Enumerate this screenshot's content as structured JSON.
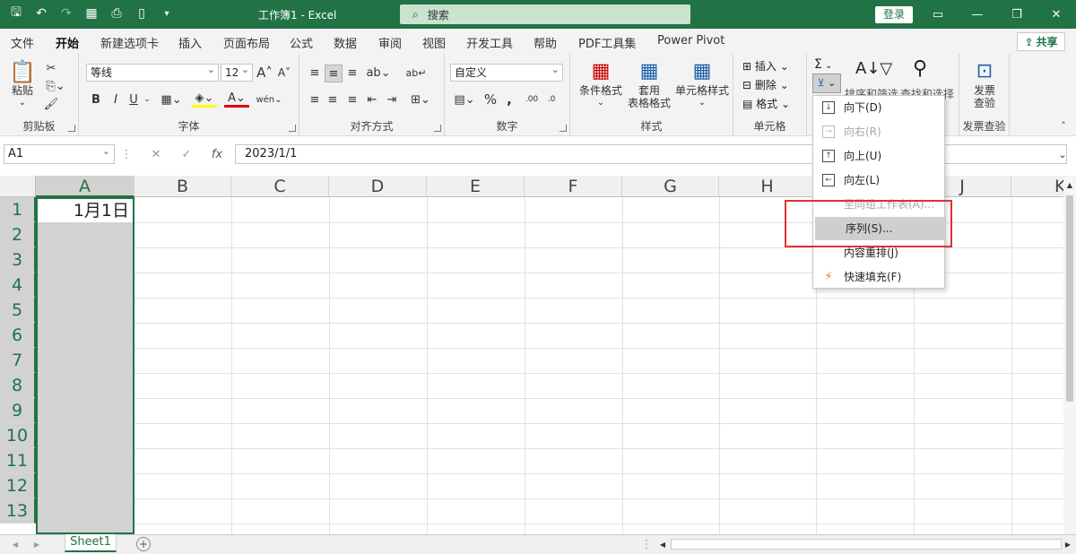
{
  "titlebar": {
    "title": "工作簿1  -  Excel",
    "search_placeholder": "搜索",
    "login_label": "登录"
  },
  "menu": {
    "tabs": [
      "文件",
      "开始",
      "新建选项卡",
      "插入",
      "页面布局",
      "公式",
      "数据",
      "审阅",
      "视图",
      "开发工具",
      "帮助",
      "PDF工具集",
      "Power Pivot"
    ],
    "active": "开始",
    "share_label": "共享"
  },
  "ribbon": {
    "clipboard": {
      "paste_label": "粘贴",
      "group_label": "剪贴板"
    },
    "font": {
      "font_name": "等线",
      "font_size": "12",
      "group_label": "字体",
      "bold": "B",
      "italic": "I",
      "underline": "U"
    },
    "alignment": {
      "group_label": "对齐方式"
    },
    "number": {
      "format": "自定义",
      "group_label": "数字",
      "percent": "%"
    },
    "styles": {
      "conditional_label": "条件格式",
      "table_label_1": "套用",
      "table_label_2": "表格格式",
      "cell_style_label": "单元格样式",
      "group_label": "样式"
    },
    "cells": {
      "insert_label": "插入",
      "delete_label": "删除",
      "format_label": "格式",
      "group_label": "单元格"
    },
    "editing": {
      "sum_symbol": "Σ",
      "sort_label": "排序和筛选",
      "find_label": "查找和选择"
    },
    "invoice": {
      "label_1": "发票",
      "label_2": "查验",
      "group_label": "发票查验"
    }
  },
  "formula": {
    "name_box": "A1",
    "fx": "fx",
    "value": "2023/1/1"
  },
  "grid": {
    "columns": [
      "A",
      "B",
      "C",
      "D",
      "E",
      "F",
      "G",
      "H",
      "I",
      "J",
      "K"
    ],
    "rows": [
      "1",
      "2",
      "3",
      "4",
      "5",
      "6",
      "7",
      "8",
      "9",
      "10",
      "11",
      "12",
      "13"
    ],
    "a1_value": "1月1日"
  },
  "fill_menu": {
    "items": [
      {
        "label": "向下(D)",
        "disabled": false,
        "icon": "↓"
      },
      {
        "label": "向右(R)",
        "disabled": true,
        "icon": "→"
      },
      {
        "label": "向上(U)",
        "disabled": false,
        "icon": "↑"
      },
      {
        "label": "向左(L)",
        "disabled": false,
        "icon": "←"
      },
      {
        "label": "至同组工作表(A)...",
        "disabled": true,
        "icon": ""
      },
      {
        "label": "序列(S)...",
        "disabled": false,
        "icon": ""
      },
      {
        "label": "内容重排(J)",
        "disabled": false,
        "icon": ""
      },
      {
        "label": "快速填充(F)",
        "disabled": false,
        "icon": "⚡"
      }
    ],
    "highlighted_index": 5
  },
  "sheets": {
    "tabs": [
      "Sheet1"
    ]
  },
  "colors": {
    "excel_green": "#217346",
    "highlight_red": "#e03030"
  }
}
